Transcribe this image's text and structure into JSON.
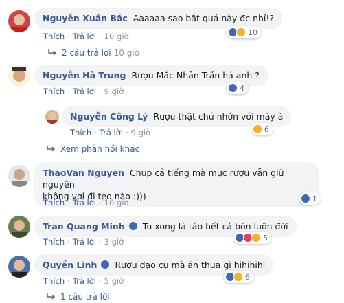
{
  "colors": {
    "name": "#385898",
    "bubble": "#f2f3f5",
    "meta": "#90949c",
    "like": "#4267b2",
    "haha": "#f7b125",
    "love": "#e9405a"
  },
  "actions": {
    "like": "Thích",
    "reply": "Trả lời"
  },
  "comments": [
    {
      "name": "Nguyễn Xuân Bắc",
      "text": "Aaaaaa sao bắt quả này đc nhỉ!?",
      "time": "10 giờ",
      "reactions": "10",
      "replies": "2 câu trả lời",
      "replies_time": "10 giờ"
    },
    {
      "name": "Nguyễn Hà Trung",
      "text": "Rượu Mắc Nhân Trần hả anh ?",
      "time": "9 giờ",
      "reactions": "4",
      "reply": {
        "name": "Nguyễn Công Lý",
        "text": "Rượu thật chứ nhờn với mày à",
        "time": "9 giờ",
        "reactions": "6"
      },
      "more": "Xem phản hồi khác"
    },
    {
      "name": "ThaoVan Nguyen",
      "text_line1": "Chụp cả tiếng mà mực rượu vẫn giữ nguyên",
      "text_line2": "không vơi đi tẹo nào :)))",
      "time": "10 giờ",
      "reactions": "1"
    },
    {
      "name": "Tran Quang Minh",
      "text": "Tu xong là táo hết cả bón luôn đới",
      "time": "3 giờ",
      "reactions": "5"
    },
    {
      "name": "Quyền Linh",
      "text": "Rượu đạo cụ mà ăn thua gì hihihihi",
      "time": "5 giờ",
      "reactions": "6",
      "replies": "1 câu trả lời"
    }
  ]
}
